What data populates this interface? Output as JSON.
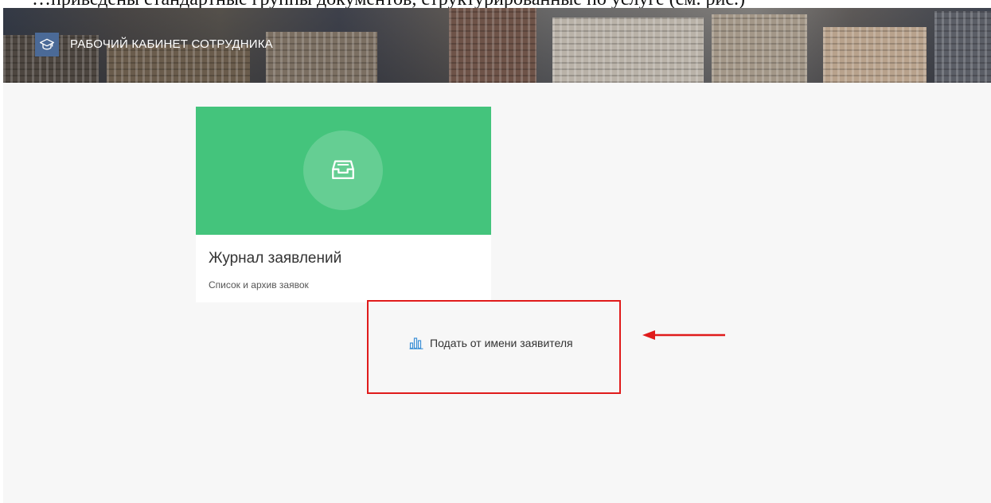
{
  "document": {
    "text_above": "…приведены стандартные группы документов, структурированные по услуге (см. рис.)"
  },
  "header": {
    "title": "РАБОЧИЙ КАБИНЕТ СОТРУДНИКА",
    "logo_icon": "graduation-cap-icon"
  },
  "cards": [
    {
      "title": "Журнал заявлений",
      "subtitle": "Список и архив заявок",
      "icon": "inbox-tray-icon",
      "color": "#44c47c"
    }
  ],
  "actions": {
    "submit_on_behalf": {
      "label": "Подать от имени заявителя",
      "icon": "bar-chart-icon",
      "icon_color": "#3a8fd6"
    }
  },
  "annotation": {
    "highlight_color": "#e01b1b"
  }
}
